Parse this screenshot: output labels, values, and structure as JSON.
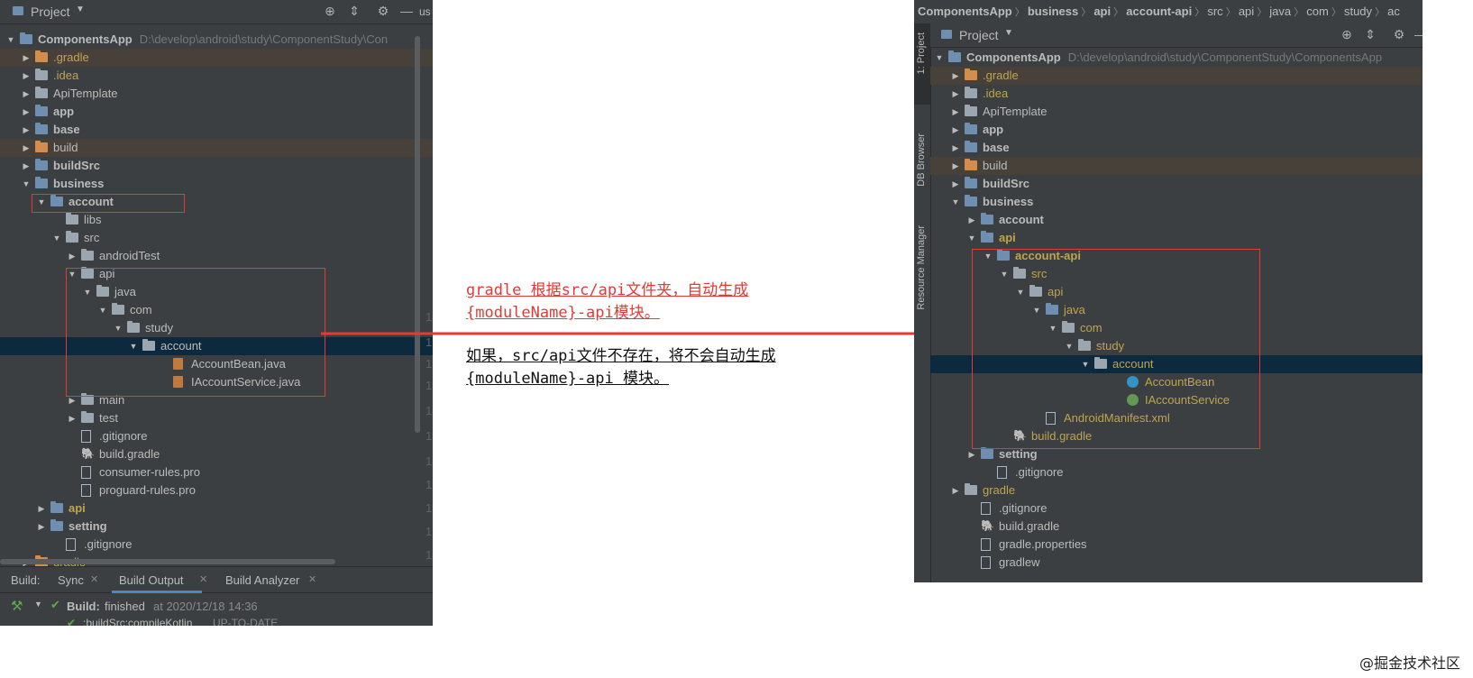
{
  "left": {
    "header": {
      "title": "Project",
      "cut_text": "us"
    },
    "tree": [
      {
        "label": "ComponentsApp",
        "path": "D:\\develop\\android\\study\\ComponentStudy\\Con",
        "indent": 0,
        "arrow": "▼",
        "icon": "blue",
        "bold": true
      },
      {
        "label": ".gradle",
        "indent": 1,
        "arrow": "▶",
        "icon": "orange",
        "style": "y",
        "hl": "excluded"
      },
      {
        "label": ".idea",
        "indent": 1,
        "arrow": "▶",
        "icon": "folder",
        "style": "y"
      },
      {
        "label": "ApiTemplate",
        "indent": 1,
        "arrow": "▶",
        "icon": "folder"
      },
      {
        "label": "app",
        "indent": 1,
        "arrow": "▶",
        "icon": "blue",
        "bold": true
      },
      {
        "label": "base",
        "indent": 1,
        "arrow": "▶",
        "icon": "blue",
        "bold": true
      },
      {
        "label": "build",
        "indent": 1,
        "arrow": "▶",
        "icon": "orange",
        "hl": "excluded"
      },
      {
        "label": "buildSrc",
        "indent": 1,
        "arrow": "▶",
        "icon": "blue",
        "bold": true
      },
      {
        "label": "business",
        "indent": 1,
        "arrow": "▼",
        "icon": "blue",
        "bold": true
      },
      {
        "label": "account",
        "indent": 2,
        "arrow": "▼",
        "icon": "blue",
        "bold": true
      },
      {
        "label": "libs",
        "indent": 3,
        "arrow": "",
        "icon": "folder"
      },
      {
        "label": "src",
        "indent": 3,
        "arrow": "▼",
        "icon": "folder"
      },
      {
        "label": "androidTest",
        "indent": 4,
        "arrow": "▶",
        "icon": "folder"
      },
      {
        "label": "api",
        "indent": 4,
        "arrow": "▼",
        "icon": "folder"
      },
      {
        "label": "java",
        "indent": 5,
        "arrow": "▼",
        "icon": "folder"
      },
      {
        "label": "com",
        "indent": 6,
        "arrow": "▼",
        "icon": "folder"
      },
      {
        "label": "study",
        "indent": 7,
        "arrow": "▼",
        "icon": "folder"
      },
      {
        "label": "account",
        "indent": 8,
        "arrow": "▼",
        "icon": "folder",
        "hl": "selected"
      },
      {
        "label": "AccountBean.java",
        "indent": 10,
        "arrow": "",
        "icon": "java"
      },
      {
        "label": "IAccountService.java",
        "indent": 10,
        "arrow": "",
        "icon": "java"
      },
      {
        "label": "main",
        "indent": 4,
        "arrow": "▶",
        "icon": "folder"
      },
      {
        "label": "test",
        "indent": 4,
        "arrow": "▶",
        "icon": "folder"
      },
      {
        "label": ".gitignore",
        "indent": 4,
        "arrow": "",
        "icon": "file"
      },
      {
        "label": "build.gradle",
        "indent": 4,
        "arrow": "",
        "icon": "gradle"
      },
      {
        "label": "consumer-rules.pro",
        "indent": 4,
        "arrow": "",
        "icon": "file"
      },
      {
        "label": "proguard-rules.pro",
        "indent": 4,
        "arrow": "",
        "icon": "file"
      },
      {
        "label": "api",
        "indent": 2,
        "arrow": "▶",
        "icon": "blue",
        "bold": true,
        "style": "y"
      },
      {
        "label": "setting",
        "indent": 2,
        "arrow": "▶",
        "icon": "blue",
        "bold": true
      },
      {
        "label": ".gitignore",
        "indent": 3,
        "arrow": "",
        "icon": "file"
      },
      {
        "label": "gradle",
        "indent": 1,
        "arrow": "▶",
        "icon": "orange",
        "style": "y"
      }
    ],
    "build_tabs": {
      "prefix": "Build:",
      "sync": "Sync",
      "output": "Build Output",
      "analyzer": "Build Analyzer"
    },
    "build_status": {
      "label": "Build:",
      "status": "finished",
      "time": "at 2020/12/18 14:36",
      "sub": ":buildSrc:compileKotlin",
      "sub_status": "UP-TO-DATE"
    }
  },
  "notes": {
    "line1": "gradle 根据src/api文件夹，自动生成",
    "line2": "{moduleName}-api模块。",
    "line3": "如果，src/api文件不存在，将不会自动生成",
    "line4": "{moduleName}-api 模块。"
  },
  "right": {
    "breadcrumb": [
      "ComponentsApp",
      "business",
      "api",
      "account-api",
      "src",
      "api",
      "java",
      "com",
      "study",
      "ac"
    ],
    "header": {
      "title": "Project"
    },
    "side_tabs": [
      "1: Project",
      "DB Browser",
      "Resource Manager"
    ],
    "tree": [
      {
        "label": "ComponentsApp",
        "path": "D:\\develop\\android\\study\\ComponentStudy\\ComponentsApp",
        "indent": 0,
        "arrow": "▼",
        "icon": "blue",
        "bold": true
      },
      {
        "label": ".gradle",
        "indent": 1,
        "arrow": "▶",
        "icon": "orange",
        "style": "y",
        "hl": "excluded"
      },
      {
        "label": ".idea",
        "indent": 1,
        "arrow": "▶",
        "icon": "folder",
        "style": "y"
      },
      {
        "label": "ApiTemplate",
        "indent": 1,
        "arrow": "▶",
        "icon": "folder"
      },
      {
        "label": "app",
        "indent": 1,
        "arrow": "▶",
        "icon": "blue",
        "bold": true
      },
      {
        "label": "base",
        "indent": 1,
        "arrow": "▶",
        "icon": "blue",
        "bold": true
      },
      {
        "label": "build",
        "indent": 1,
        "arrow": "▶",
        "icon": "orange",
        "hl": "excluded"
      },
      {
        "label": "buildSrc",
        "indent": 1,
        "arrow": "▶",
        "icon": "blue",
        "bold": true
      },
      {
        "label": "business",
        "indent": 1,
        "arrow": "▼",
        "icon": "blue",
        "bold": true
      },
      {
        "label": "account",
        "indent": 2,
        "arrow": "▶",
        "icon": "blue",
        "bold": true
      },
      {
        "label": "api",
        "indent": 2,
        "arrow": "▼",
        "icon": "blue",
        "bold": true,
        "style": "y"
      },
      {
        "label": "account-api",
        "indent": 3,
        "arrow": "▼",
        "icon": "blue",
        "bold": true,
        "style": "y"
      },
      {
        "label": "src",
        "indent": 4,
        "arrow": "▼",
        "icon": "folder",
        "style": "y"
      },
      {
        "label": "api",
        "indent": 5,
        "arrow": "▼",
        "icon": "folder",
        "style": "y"
      },
      {
        "label": "java",
        "indent": 6,
        "arrow": "▼",
        "icon": "blue",
        "style": "y"
      },
      {
        "label": "com",
        "indent": 7,
        "arrow": "▼",
        "icon": "folder",
        "style": "y"
      },
      {
        "label": "study",
        "indent": 8,
        "arrow": "▼",
        "icon": "folder",
        "style": "y"
      },
      {
        "label": "account",
        "indent": 9,
        "arrow": "▼",
        "icon": "folder",
        "style": "y",
        "hl": "selected"
      },
      {
        "label": "AccountBean",
        "indent": 11,
        "arrow": "",
        "icon": "cls",
        "style": "y"
      },
      {
        "label": "IAccountService",
        "indent": 11,
        "arrow": "",
        "icon": "intf",
        "style": "y"
      },
      {
        "label": "AndroidManifest.xml",
        "indent": 6,
        "arrow": "",
        "icon": "file",
        "style": "y"
      },
      {
        "label": "build.gradle",
        "indent": 4,
        "arrow": "",
        "icon": "gradle",
        "style": "y"
      },
      {
        "label": "setting",
        "indent": 2,
        "arrow": "▶",
        "icon": "blue",
        "bold": true
      },
      {
        "label": ".gitignore",
        "indent": 3,
        "arrow": "",
        "icon": "file"
      },
      {
        "label": "gradle",
        "indent": 1,
        "arrow": "▶",
        "icon": "folder",
        "style": "y"
      },
      {
        "label": ".gitignore",
        "indent": 2,
        "arrow": "",
        "icon": "file"
      },
      {
        "label": "build.gradle",
        "indent": 2,
        "arrow": "",
        "icon": "gradle"
      },
      {
        "label": "gradle.properties",
        "indent": 2,
        "arrow": "",
        "icon": "file"
      },
      {
        "label": "gradlew",
        "indent": 2,
        "arrow": "",
        "icon": "file"
      }
    ]
  },
  "watermark": "@掘金技术社区",
  "colors": {
    "ide_bg": "#3c3f41",
    "annotation_red": "#e53935",
    "note_red": "#e53935",
    "note_dark": "#111111"
  }
}
